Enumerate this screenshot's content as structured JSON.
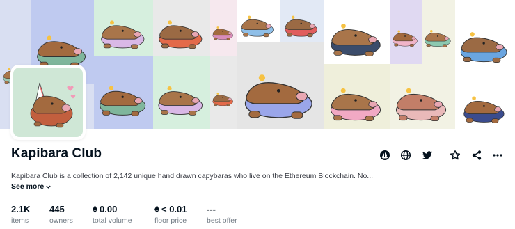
{
  "collection": {
    "name": "Kapibara Club",
    "description": "Kapibara Club is a collection of 2,142 unique hand drawn capybaras who live on the Ethereum Blockchain. No...",
    "see_more_label": "See more"
  },
  "stats": [
    {
      "value": "2.1K",
      "label": "items",
      "eth": false
    },
    {
      "value": "445",
      "label": "owners",
      "eth": false
    },
    {
      "value": "0.00",
      "label": "total volume",
      "eth": true
    },
    {
      "value": "< 0.01",
      "label": "floor price",
      "eth": true
    },
    {
      "value": "---",
      "label": "best offer",
      "eth": false
    }
  ],
  "actions": [
    {
      "name": "opensea-link-icon"
    },
    {
      "name": "website-globe-icon"
    },
    {
      "name": "twitter-icon"
    },
    {
      "name": "watchlist-star-icon"
    },
    {
      "name": "share-icon"
    },
    {
      "name": "more-options-icon"
    }
  ],
  "colors": {
    "text_primary": "#04111d",
    "text_secondary": "#707a83",
    "divider": "#e5e8eb",
    "avatar_bg": "#cfe7d6"
  },
  "banner_tiles": [
    {
      "bg": "#d9dff2",
      "body": "#a9754a",
      "shirt": "#9bc7b2"
    },
    {
      "bg": "#bfcaf0",
      "body": "#a36a3f",
      "shirt": "#7fb69c"
    },
    {
      "bg": "#d6efde",
      "body": "#a9754a",
      "shirt": "#d9b8e6"
    },
    {
      "bg": "#e9e9e9",
      "body": "#9b6a44",
      "shirt": "#e36a4a"
    },
    {
      "bg": "#f6e8ee",
      "body": "#a36a3f",
      "shirt": "#d98cb8"
    },
    {
      "bg": "#ffffff",
      "body": "#a9754a",
      "shirt": "#8fbfe8"
    },
    {
      "bg": "#e2e9f5",
      "body": "#9b6a44",
      "shirt": "#e05d5d"
    },
    {
      "bg": "#ffffff",
      "body": "#a9754a",
      "shirt": "#3b4c6b"
    },
    {
      "bg": "#e0d9f2",
      "body": "#a36a3f",
      "shirt": "#f0b4c8"
    },
    {
      "bg": "#f2f2e4",
      "body": "#a9754a",
      "shirt": "#8cc9b0"
    },
    {
      "bg": "#ffffff",
      "body": "#9b6a44",
      "shirt": "#6aa5e0"
    },
    {
      "bg": "#e5e5e5",
      "body": "#a36a3f",
      "shirt": "#9aa6ea"
    },
    {
      "bg": "#efefdb",
      "body": "#a9754a",
      "shirt": "#f1a9c4"
    },
    {
      "bg": "#f2f2e4",
      "body": "#c27e68",
      "shirt": "#e9b9b9"
    },
    {
      "bg": "#ffffff",
      "body": "#a36a3f",
      "shirt": "#3b4c8e"
    }
  ]
}
